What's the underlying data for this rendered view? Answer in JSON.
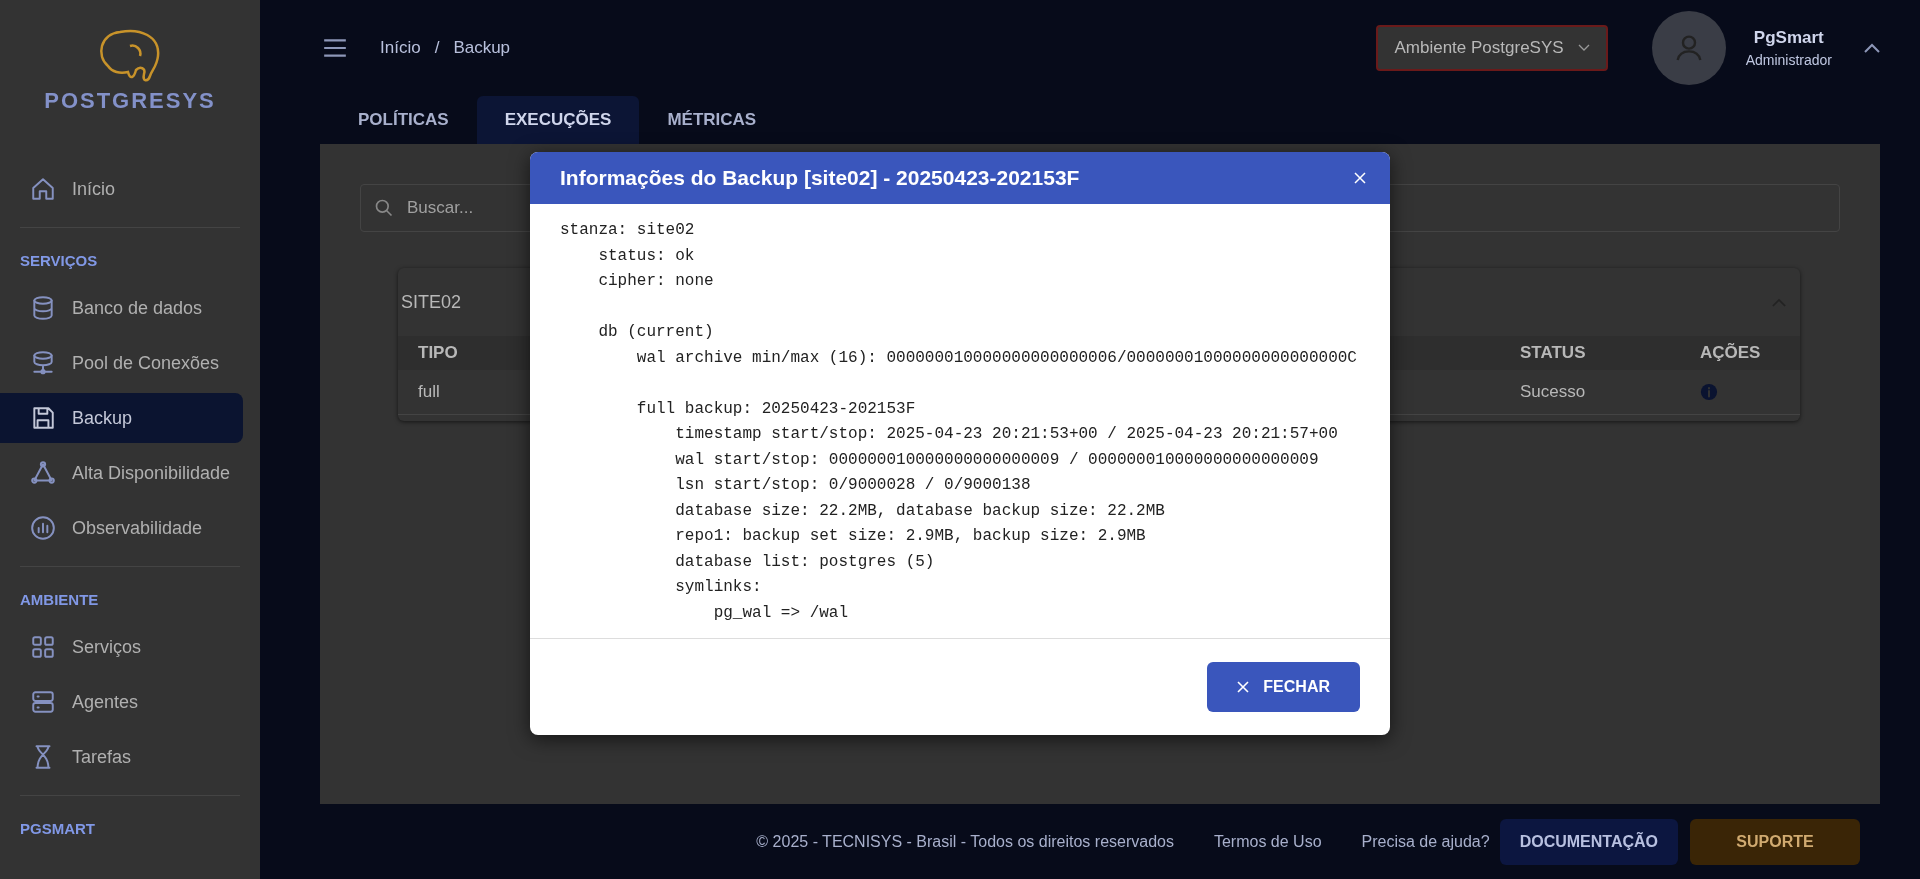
{
  "sidebar": {
    "logo": "POSTGRESYS",
    "groups": [
      {
        "items": [
          {
            "label": "Início",
            "selected": false
          }
        ]
      },
      {
        "heading": "SERVIÇOS",
        "items": [
          {
            "label": "Banco de dados",
            "selected": false
          },
          {
            "label": "Pool de Conexões",
            "selected": false
          },
          {
            "label": "Backup",
            "selected": true
          },
          {
            "label": "Alta Disponibilidade",
            "selected": false
          },
          {
            "label": "Observabilidade",
            "selected": false
          }
        ]
      },
      {
        "heading": "AMBIENTE",
        "items": [
          {
            "label": "Serviços",
            "selected": false
          },
          {
            "label": "Agentes",
            "selected": false
          },
          {
            "label": "Tarefas",
            "selected": false
          }
        ]
      },
      {
        "heading": "PGSMART"
      }
    ]
  },
  "header": {
    "breadcrumb": [
      "Início",
      "Backup"
    ],
    "separator": "/",
    "environment": "Ambiente PostgreSYS",
    "user": {
      "name": "PgSmart",
      "role": "Administrador"
    }
  },
  "tabs": [
    {
      "label": "POLÍTICAS",
      "selected": false
    },
    {
      "label": "EXECUÇÕES",
      "selected": true
    },
    {
      "label": "MÉTRICAS",
      "selected": false
    }
  ],
  "search": {
    "placeholder": "Buscar..."
  },
  "card": {
    "title": "SITE02",
    "expanded": true,
    "columns": [
      "TIPO",
      "STATUS",
      "AÇÕES"
    ],
    "rows": [
      {
        "cells": [
          "full",
          "Sucesso"
        ]
      }
    ]
  },
  "modal": {
    "title": "Informações do Backup [site02] - 20250423-202153F",
    "lines": [
      {
        "text": "stanza: site02",
        "children": [
          {
            "text": "status: ok"
          },
          {
            "text": "cipher: none"
          },
          {
            "text": "db (current)",
            "gap_before": true,
            "children": [
              {
                "text": "wal archive min/max (16): 000000010000000000000006/00000001000000000000000C"
              },
              {
                "text": "full backup: 20250423-202153F",
                "gap_before": true,
                "children": [
                  {
                    "text": "timestamp start/stop: 2025-04-23 20:21:53+00 / 2025-04-23 20:21:57+00"
                  },
                  {
                    "text": "wal start/stop: 000000010000000000000009 / 000000010000000000000009"
                  },
                  {
                    "text": "lsn start/stop: 0/9000028 / 0/9000138"
                  },
                  {
                    "text": "database size: 22.2MB, database backup size: 22.2MB"
                  },
                  {
                    "text": "repo1: backup set size: 2.9MB, backup size: 2.9MB"
                  },
                  {
                    "text": "database list: postgres (5)"
                  },
                  {
                    "text": "symlinks:",
                    "children": [
                      {
                        "text": "pg_wal => /wal"
                      }
                    ]
                  }
                ]
              }
            ]
          }
        ]
      }
    ],
    "close_button": "FECHAR"
  },
  "footer": {
    "copyright": "© 2025 - TECNISYS - Brasil - Todos os direitos reservados",
    "links": [
      "Termos de Uso",
      "Precisa de ajuda?"
    ],
    "buttons": [
      {
        "label": "DOCUMENTAÇÃO",
        "kind": "primary"
      },
      {
        "label": "SUPORTE",
        "kind": "warning"
      }
    ]
  }
}
